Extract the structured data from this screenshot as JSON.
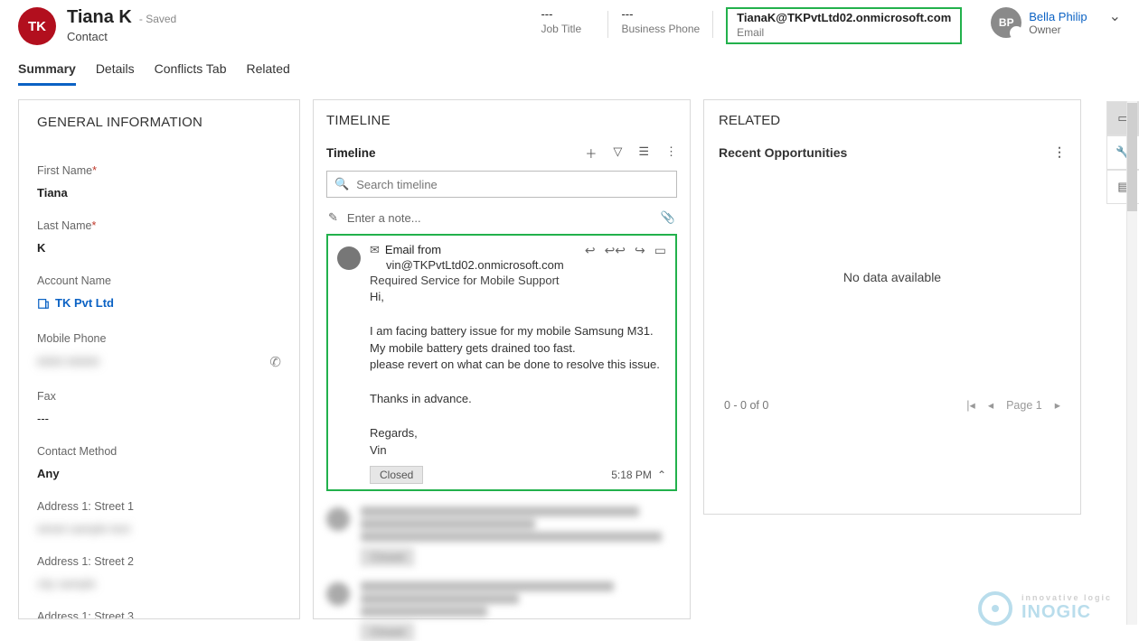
{
  "header": {
    "initials": "TK",
    "contact_name": "Tiana K",
    "saved_label": "- Saved",
    "subtype": "Contact",
    "job_title_value": "---",
    "job_title_label": "Job Title",
    "business_phone_value": "---",
    "business_phone_label": "Business Phone",
    "email_value": "TianaK@TKPvtLtd02.onmicrosoft.com",
    "email_label": "Email",
    "owner_initials": "BP",
    "owner_name": "Bella Philip",
    "owner_role": "Owner"
  },
  "tabs": [
    "Summary",
    "Details",
    "Conflicts Tab",
    "Related"
  ],
  "active_tab_index": 0,
  "general": {
    "section_title": "GENERAL INFORMATION",
    "fields": {
      "first_name_label": "First Name",
      "first_name_value": "Tiana",
      "last_name_label": "Last Name",
      "last_name_value": "K",
      "account_name_label": "Account Name",
      "account_name_value": "TK Pvt Ltd",
      "mobile_phone_label": "Mobile Phone",
      "mobile_phone_value": "0000 00000",
      "fax_label": "Fax",
      "fax_value": "---",
      "contact_method_label": "Contact Method",
      "contact_method_value": "Any",
      "addr1_street1_label": "Address 1: Street 1",
      "addr1_street1_value": "street sample text",
      "addr1_street2_label": "Address 1: Street 2",
      "addr1_street2_value": "city sample",
      "addr1_street3_label": "Address 1: Street 3"
    }
  },
  "timeline": {
    "section_title": "TIMELINE",
    "subheader": "Timeline",
    "search_placeholder": "Search timeline",
    "note_placeholder": "Enter a note...",
    "email": {
      "from_label": "Email from",
      "from_address": "vin@TKPvtLtd02.onmicrosoft.com",
      "subject": "Required Service for Mobile Support",
      "body": "Hi,\n\nI am facing battery issue for my mobile Samsung M31.\nMy mobile battery gets drained too fast.\nplease revert on what can be done to resolve this issue.\n\nThanks in advance.\n\nRegards,\nVin",
      "status": "Closed",
      "time": "5:18 PM"
    }
  },
  "related": {
    "section_title": "RELATED",
    "subheader": "Recent Opportunities",
    "empty_text": "No data available",
    "range_text": "0 - 0 of 0",
    "page_text": "Page 1"
  },
  "watermark": {
    "brand": "INOGIC",
    "tagline": "innovative logic"
  }
}
